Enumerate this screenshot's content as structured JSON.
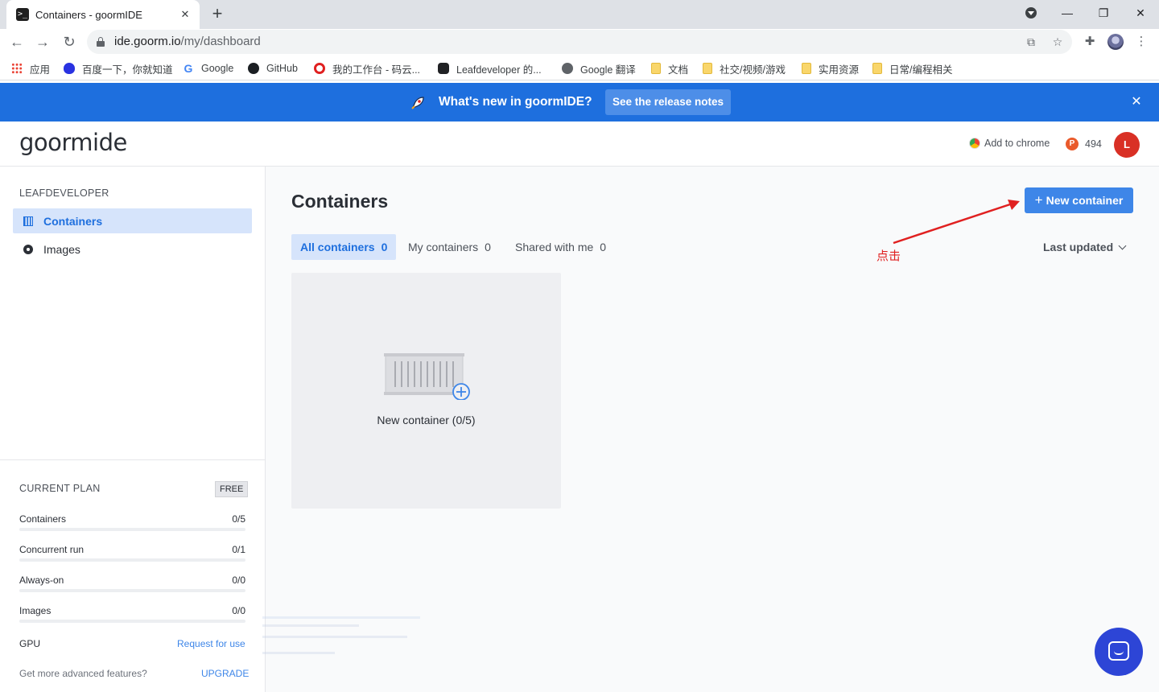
{
  "browser": {
    "tab_title": "Containers - goormIDE",
    "tab_favicon_text": ">_",
    "url_host": "ide.goorm.io",
    "url_path": "/my/dashboard",
    "bookmarks": [
      {
        "label": "应用",
        "icon": "apps-icon"
      },
      {
        "label": "百度一下，你就知道",
        "icon": "baidu-icon"
      },
      {
        "label": "Google",
        "icon": "google-icon"
      },
      {
        "label": "GitHub",
        "icon": "github-icon"
      },
      {
        "label": "我的工作台 - 码云...",
        "icon": "gitee-icon"
      },
      {
        "label": "Leafdeveloper 的...",
        "icon": "leafdeveloper-icon"
      },
      {
        "label": "Google 翻译",
        "icon": "translate-icon"
      },
      {
        "label": "文档",
        "icon": "folder-icon"
      },
      {
        "label": "社交/视频/游戏",
        "icon": "folder-icon"
      },
      {
        "label": "实用资源",
        "icon": "folder-icon"
      },
      {
        "label": "日常/编程相关",
        "icon": "folder-icon"
      }
    ]
  },
  "banner": {
    "text": "What's new in goormIDE?",
    "button_label": "See the release notes",
    "background_color": "#1e6fde"
  },
  "header": {
    "logo": "goormide",
    "add_to_chrome": "Add to chrome",
    "points": "494",
    "points_icon_letter": "P",
    "avatar_letter": "L"
  },
  "sidebar": {
    "group_title": "LEAFDEVELOPER",
    "items": [
      {
        "label": "Containers",
        "active": true
      },
      {
        "label": "Images",
        "active": false
      }
    ],
    "plan": {
      "title": "CURRENT PLAN",
      "badge": "FREE",
      "rows": [
        {
          "label": "Containers",
          "value": "0/5"
        },
        {
          "label": "Concurrent run",
          "value": "0/1"
        },
        {
          "label": "Always-on",
          "value": "0/0"
        },
        {
          "label": "Images",
          "value": "0/0"
        }
      ],
      "gpu_label": "GPU",
      "gpu_link": "Request for use",
      "upgrade_prompt": "Get more advanced features?",
      "upgrade_link": "UPGRADE"
    }
  },
  "main": {
    "title": "Containers",
    "new_button": "New container",
    "new_button_plus": "+",
    "filters": [
      {
        "label": "All containers",
        "count": "0",
        "active": true
      },
      {
        "label": "My containers",
        "count": "0",
        "active": false
      },
      {
        "label": "Shared with me",
        "count": "0",
        "active": false
      }
    ],
    "sort_label": "Last updated",
    "new_card_label": "New container (0/5)",
    "annotation_text": "点击"
  },
  "colors": {
    "accent": "#3e86e8",
    "active_bg": "#d6e4fb",
    "annotation": "#e02020",
    "chat": "#2d45d6"
  }
}
